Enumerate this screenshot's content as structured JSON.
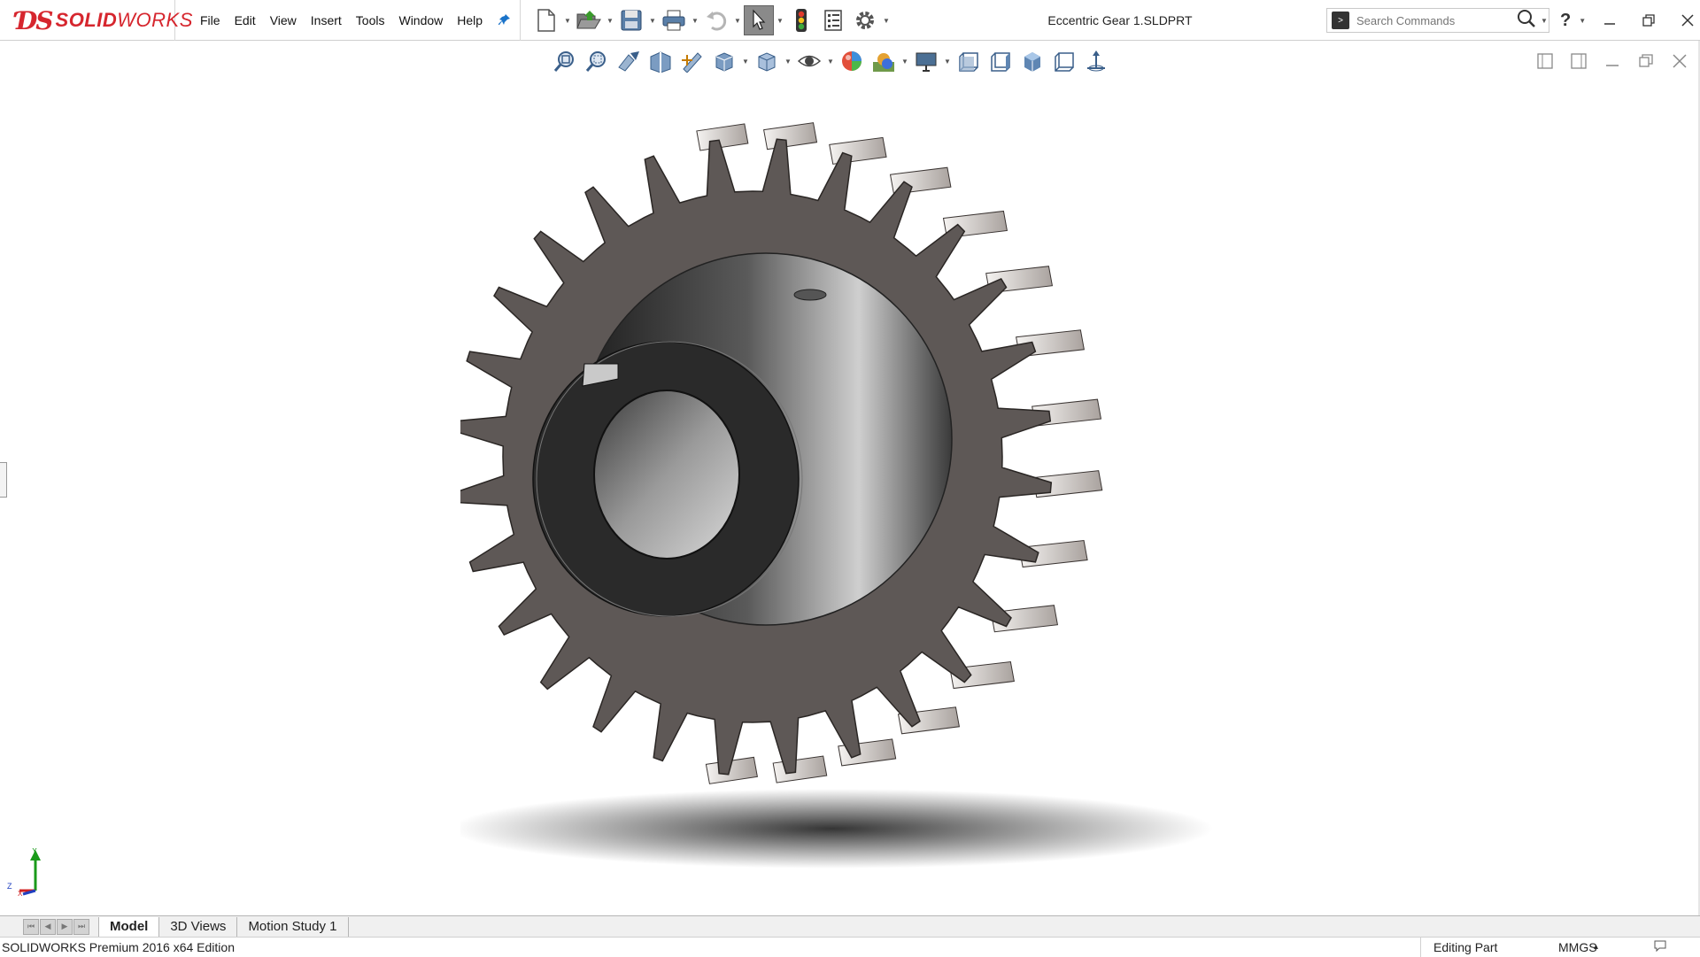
{
  "app": {
    "brand_mark": "ƊS",
    "brand_bold": "SOLID",
    "brand_light": "WORKS"
  },
  "menu": {
    "items": [
      "File",
      "Edit",
      "View",
      "Insert",
      "Tools",
      "Window",
      "Help"
    ]
  },
  "document": {
    "title": "Eccentric Gear 1.SLDPRT"
  },
  "search": {
    "placeholder": "Search Commands"
  },
  "help": {
    "label": "?"
  },
  "tabs": [
    {
      "label": "Model",
      "active": true
    },
    {
      "label": "3D Views",
      "active": false
    },
    {
      "label": "Motion Study 1",
      "active": false
    }
  ],
  "triad": {
    "y": "Y",
    "z": "Z",
    "x": "X"
  },
  "status": {
    "edition": "SOLIDWORKS Premium 2016 x64 Edition",
    "mode": "Editing Part",
    "units": "MMGS",
    "units_arrow": "▴"
  },
  "colors": {
    "brand": "#d6262e",
    "gear_face": "#5e5856",
    "hub_dark": "#2a2a2a"
  },
  "icons": {
    "toolbar": [
      "new-document-icon",
      "open-icon",
      "save-icon",
      "print-icon",
      "undo-icon",
      "select-icon",
      "rebuild-icon",
      "file-properties-icon",
      "options-icon"
    ],
    "heads_up": [
      "zoom-to-fit-icon",
      "zoom-to-area-icon",
      "previous-view-icon",
      "section-view-icon",
      "dynamic-annotation-icon",
      "view-orientation-icon",
      "display-style-icon",
      "hide-show-icon",
      "edit-appearance-icon",
      "apply-scene-icon",
      "view-settings-icon",
      "front-view-icon",
      "right-view-icon",
      "isometric-view-icon",
      "normal-to-icon",
      "rotate-icon"
    ]
  }
}
